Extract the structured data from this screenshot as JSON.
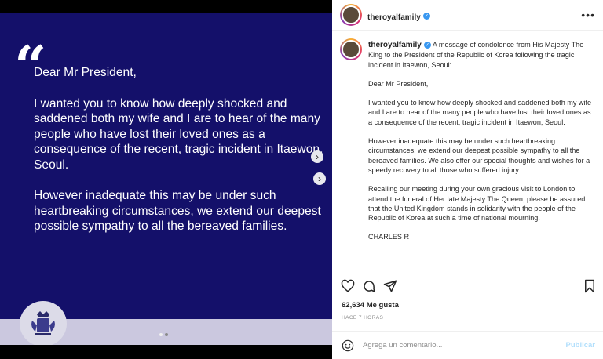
{
  "slide": {
    "quote_mark": "“",
    "paragraphs": [
      "Dear Mr President,",
      "I wanted you to know how deeply shocked and saddened both my wife and I are to hear of the many people who have lost their loved ones as a consequence of the recent, tragic incident in Itaewon, Seoul.",
      "However inadequate this may be under such heartbreaking circumstances, we extend our deepest possible sympathy to all the bereaved families."
    ],
    "background_color": "#14106a",
    "carousel_total": 2,
    "carousel_active": 1
  },
  "header": {
    "username": "theroyalfamily"
  },
  "caption": {
    "username": "theroyalfamily",
    "intro": "A message of condolence from His Majesty The King to the President of the Republic of Korea following the tragic incident in Itaewon, Seoul:",
    "paragraphs": [
      "Dear Mr President,",
      "I wanted you to know how deeply shocked and saddened both my wife and I are to hear of the many people who have lost their loved ones as a consequence of the recent, tragic incident in Itaewon, Seoul.",
      "However inadequate this may be under such heartbreaking circumstances, we extend our deepest possible sympathy to all the bereaved families. We also offer our special thoughts and wishes for a speedy recovery to all those who suffered injury.",
      "Recalling our meeting during your own gracious visit to London to attend the funeral of Her late Majesty The Queen, please be assured that the United Kingdom stands in solidarity with the people of the Republic of Korea at such a time of national mourning."
    ],
    "signature": "CHARLES R"
  },
  "engagement": {
    "likes": "62,634 Me gusta",
    "time": "HACE 7 HORAS"
  },
  "comment": {
    "placeholder": "Agrega un comentario...",
    "post_label": "Publicar"
  },
  "icons": [
    "heart-icon",
    "comment-icon",
    "share-icon",
    "bookmark-icon",
    "emoji-icon",
    "more-icon",
    "verified-icon",
    "next-arrow-icon"
  ],
  "colors": {
    "verified": "#3897f0",
    "post_button": "#b2dffc",
    "muted": "#8e8e8e"
  }
}
